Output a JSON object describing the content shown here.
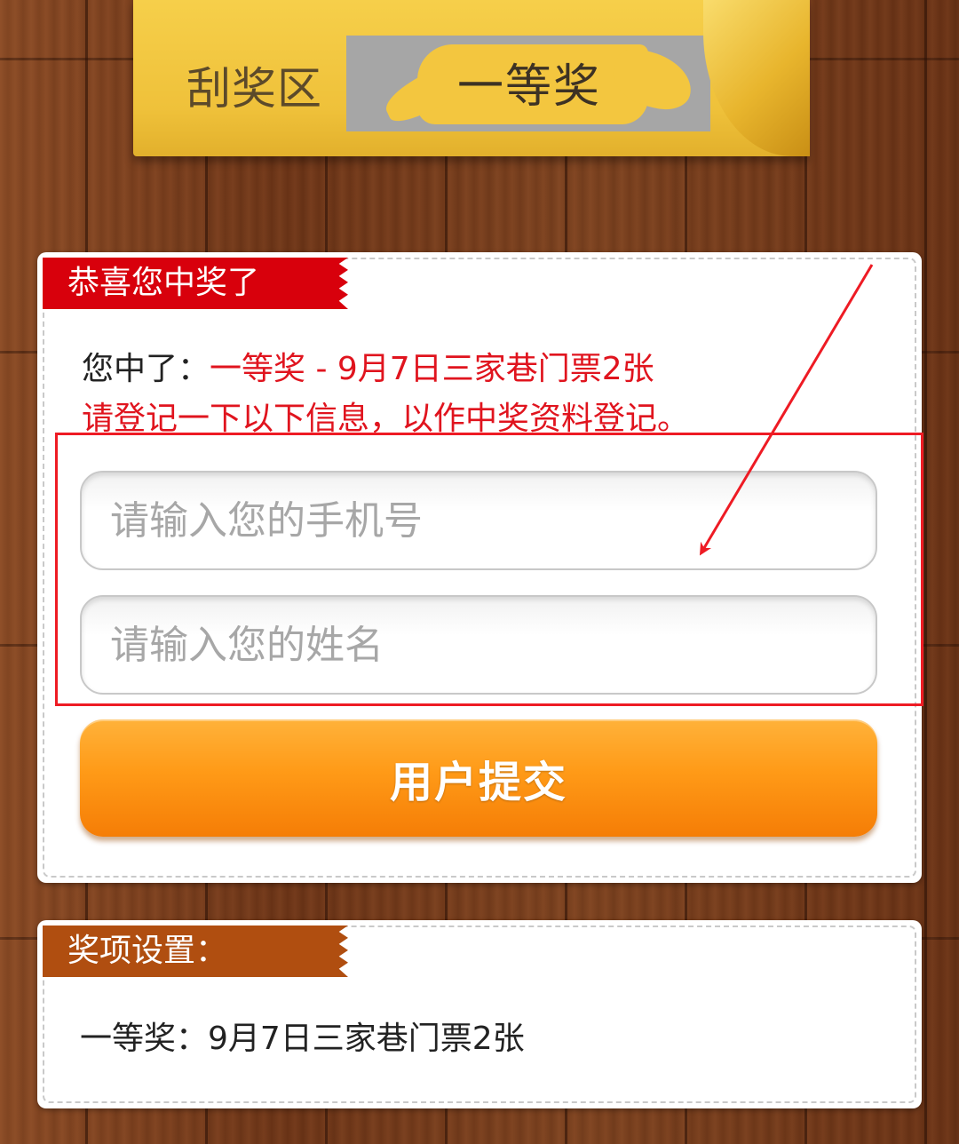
{
  "scratch": {
    "label": "刮奖区",
    "prize": "一等奖"
  },
  "win_card": {
    "ribbon": "恭喜您中奖了",
    "win_prefix": "您中了：",
    "win_prize": "一等奖 - 9月7日三家巷门票2张",
    "notice": "请登记一下以下信息，以作中奖资料登记。",
    "phone_placeholder": "请输入您的手机号",
    "name_placeholder": "请输入您的姓名",
    "submit_label": "用户提交"
  },
  "prizes_card": {
    "ribbon": "奖项设置：",
    "items": [
      "一等奖：9月7日三家巷门票2张"
    ]
  },
  "colors": {
    "accent_red": "#e0141e",
    "ribbon_red": "#d8000c",
    "ribbon_brown": "#b04e10",
    "button_orange": "#ff9a17",
    "banner_yellow": "#f3c63f",
    "annotation_red": "#ee1b24"
  }
}
